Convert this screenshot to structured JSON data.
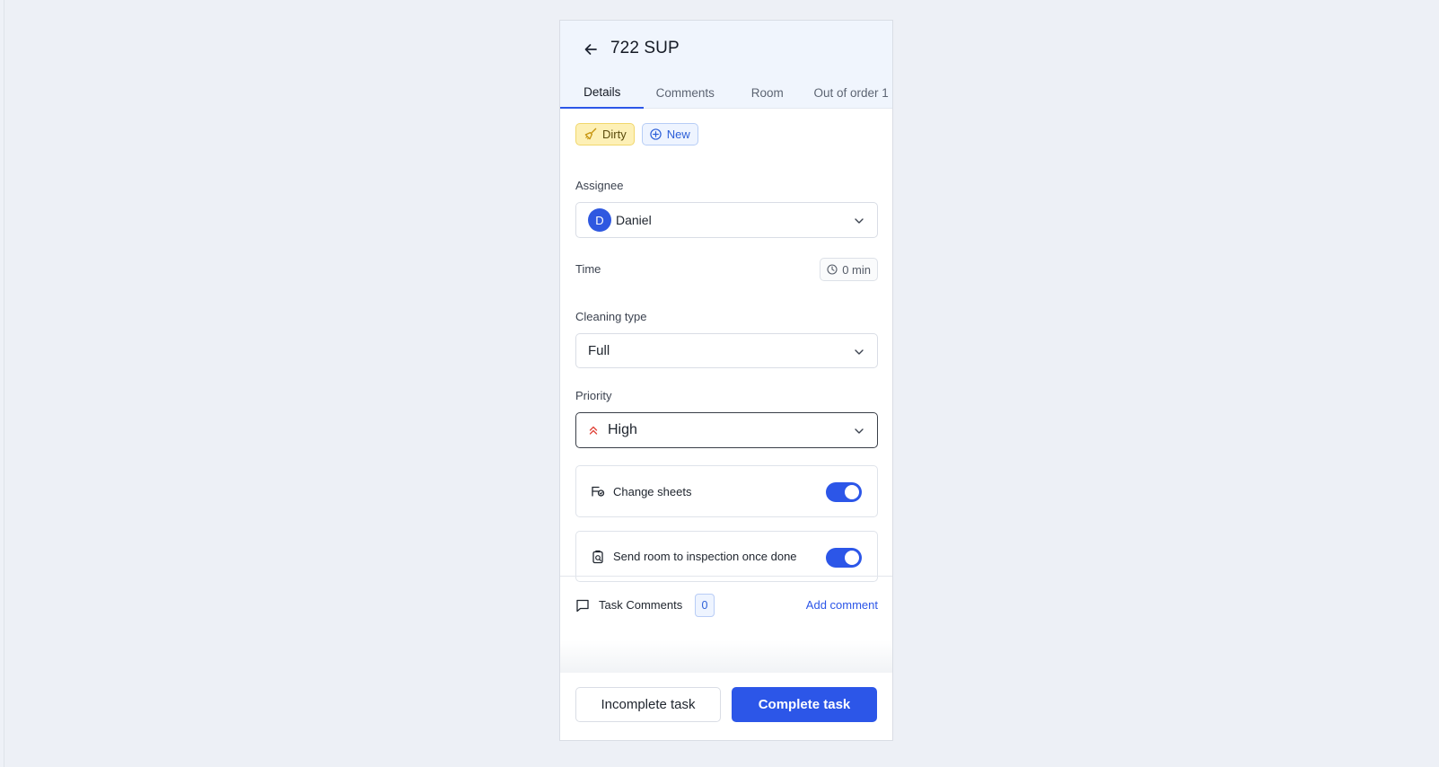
{
  "header": {
    "title": "722 SUP",
    "tabs": [
      {
        "label": "Details",
        "active": true
      },
      {
        "label": "Comments",
        "active": false
      },
      {
        "label": "Room",
        "active": false
      },
      {
        "label": "Out of order 1",
        "active": false
      }
    ]
  },
  "badges": {
    "status": {
      "label": "Dirty",
      "icon": "broom-icon"
    },
    "new": {
      "label": "New",
      "icon": "plus-circle-icon"
    }
  },
  "assignee": {
    "label": "Assignee",
    "avatar_initial": "D",
    "name": "Daniel"
  },
  "time": {
    "label": "Time",
    "value": "0 min"
  },
  "cleaning_type": {
    "label": "Cleaning type",
    "value": "Full"
  },
  "priority": {
    "label": "Priority",
    "value": "High",
    "icon": "double-chevron-up-icon"
  },
  "toggles": [
    {
      "label": "Change sheets",
      "on": true,
      "icon": "bed-sheets-icon"
    },
    {
      "label": "Send room to inspection once done",
      "on": true,
      "icon": "inspection-icon"
    }
  ],
  "task_comments": {
    "title": "Task Comments",
    "count": "0",
    "add_label": "Add comment"
  },
  "footer": {
    "incomplete_label": "Incomplete task",
    "complete_label": "Complete task"
  },
  "colors": {
    "accent": "#2c56e8",
    "dirty_badge_bg": "#fdf0b6",
    "priority_high": "#e0453a"
  }
}
